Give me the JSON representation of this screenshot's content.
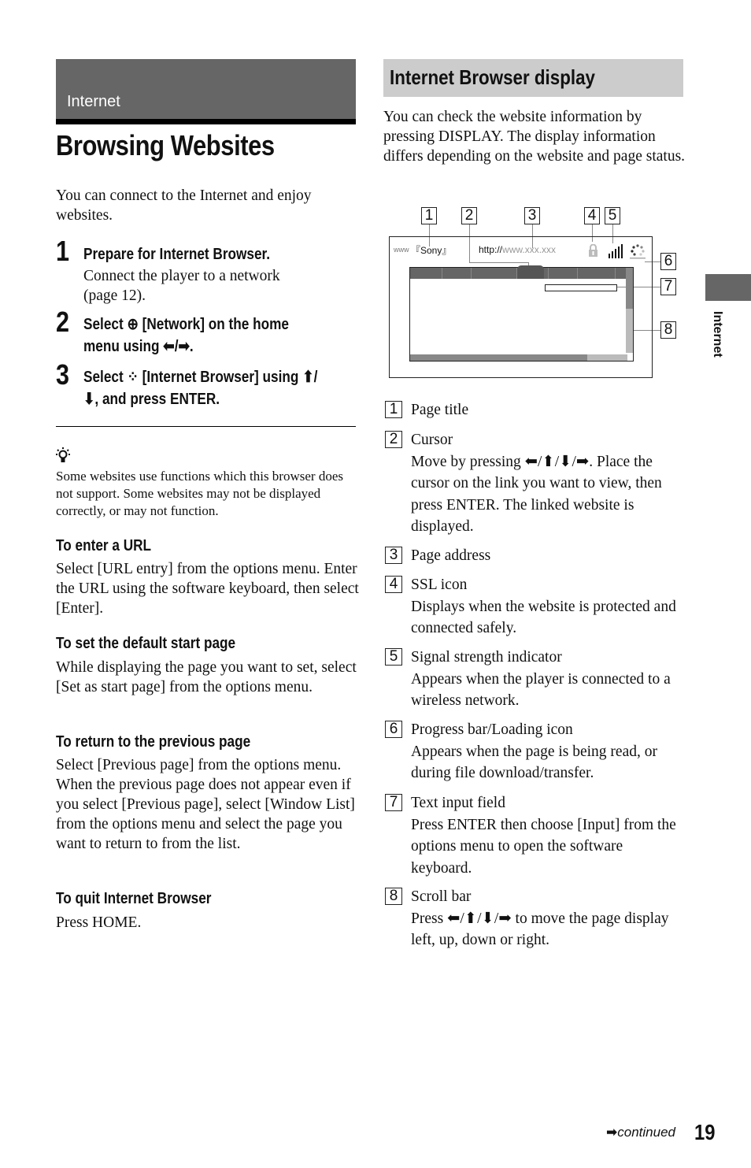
{
  "section": {
    "label": "Internet"
  },
  "title": "Browsing Websites",
  "intro": "You can connect to the Internet and enjoy websites.",
  "steps": [
    {
      "num": "1",
      "head": "Prepare for Internet Browser.",
      "body": "Connect the player to a network (page 12)."
    },
    {
      "num": "2",
      "head_line1": "Select ⊕ [Network] on the home",
      "head_line2": "menu using ⬅/➡."
    },
    {
      "num": "3",
      "head_line1": "Select ⁘ [Internet Browser] using ⬆/",
      "head_line2": "⬇, and press ENTER."
    }
  ],
  "tip": {
    "icon": "lightbulb-icon",
    "text": "Some websites use functions which this browser does not support. Some websites may not be displayed correctly, or may not function."
  },
  "subsections": [
    {
      "head": "To enter a URL",
      "body": "Select [URL entry] from the options menu. Enter the URL using the software keyboard, then select [Enter]."
    },
    {
      "head": "To set the default start page",
      "body": "While displaying the page you want to set, select [Set as start page] from the options menu."
    },
    {
      "head": "To return to the previous page",
      "body": "Select [Previous page] from the options menu. When the previous page does not appear even if you select [Previous page], select [Window List] from the options menu and select the page you want to return to from the list."
    },
    {
      "head": "To quit Internet Browser",
      "body": "Press HOME."
    }
  ],
  "display": {
    "heading": "Internet Browser display",
    "intro": "You can check the website information by pressing DISPLAY. The display information differs depending on the website and page status.",
    "diagram": {
      "page_title": "『Sony』",
      "url_prefix": "http://",
      "url_rest": "www.xxx.xxx",
      "www_icon": "www",
      "callouts": [
        "1",
        "2",
        "3",
        "4",
        "5",
        "6",
        "7",
        "8"
      ]
    },
    "items": [
      {
        "num": "1",
        "title": "Page title",
        "desc": ""
      },
      {
        "num": "2",
        "title": "Cursor",
        "desc": "Move by pressing ⬅/⬆/⬇/➡. Place the cursor on the link you want to view, then press ENTER. The linked website is displayed."
      },
      {
        "num": "3",
        "title": "Page address",
        "desc": ""
      },
      {
        "num": "4",
        "title": "SSL icon",
        "desc": "Displays when the website is protected and connected safely."
      },
      {
        "num": "5",
        "title": "Signal strength indicator",
        "desc": "Appears when the player is connected to a wireless network."
      },
      {
        "num": "6",
        "title": "Progress bar/Loading icon",
        "desc": "Appears when the page is being read, or during file download/transfer."
      },
      {
        "num": "7",
        "title": "Text input field",
        "desc": "Press ENTER then choose [Input] from the options menu to open the software keyboard."
      },
      {
        "num": "8",
        "title": "Scroll bar",
        "desc": "Press ⬅/⬆/⬇/➡ to move the page display left, up, down or right."
      }
    ]
  },
  "side_tab": {
    "label": "Internet"
  },
  "footer": {
    "continued": "continued",
    "page": "19"
  }
}
